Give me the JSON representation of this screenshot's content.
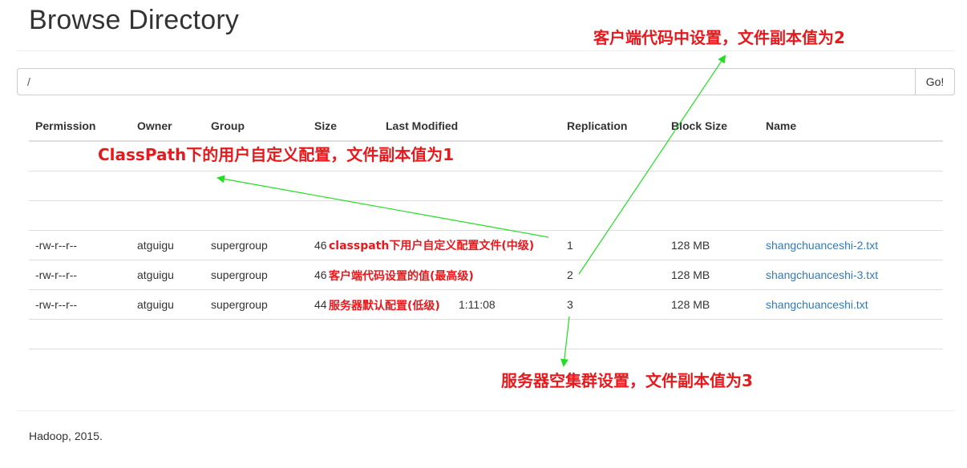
{
  "page": {
    "title": "Browse Directory"
  },
  "path_bar": {
    "value": "/",
    "go_label": "Go!"
  },
  "table": {
    "headers": [
      "Permission",
      "Owner",
      "Group",
      "Size",
      "Last Modified",
      "Replication",
      "Block Size",
      "Name"
    ],
    "rows": [
      {
        "permission": "-rw-r--r--",
        "owner": "atguigu",
        "group": "supergroup",
        "size": "46",
        "last_modified": "",
        "replication": "1",
        "block_size": "128 MB",
        "name": "shangchuanceshi-2.txt"
      },
      {
        "permission": "-rw-r--r--",
        "owner": "atguigu",
        "group": "supergroup",
        "size": "46",
        "last_modified": "",
        "replication": "2",
        "block_size": "128 MB",
        "name": "shangchuanceshi-3.txt"
      },
      {
        "permission": "-rw-r--r--",
        "owner": "atguigu",
        "group": "supergroup",
        "size": "44",
        "last_modified": "1:11:08",
        "replication": "3",
        "block_size": "128 MB",
        "name": "shangchuanceshi.txt"
      }
    ]
  },
  "annotations": {
    "client_code": "客户端代码中设置，文件副本值为2",
    "classpath": "ClassPath下的用户自定义配置，文件副本值为1",
    "server_cluster": "服务器空集群设置，文件副本值为3",
    "row1_note": "classpath下用户自定义配置文件(中级)",
    "row2_note": "客户端代码设置的值(最高级)",
    "row3_note": "服务器默认配置(低级)",
    "arrow_color": "#22dd22",
    "note_color": "#e8191d"
  },
  "footer": {
    "text": "Hadoop, 2015."
  }
}
